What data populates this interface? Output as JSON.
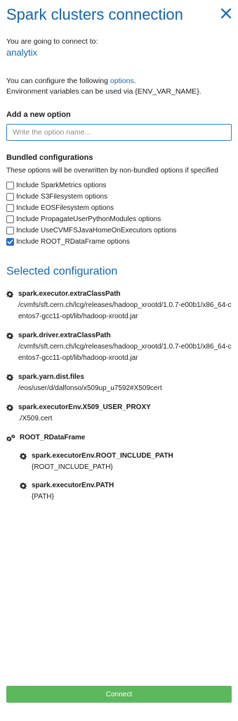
{
  "header": {
    "title": "Spark clusters connection"
  },
  "intro": {
    "text": "You are going to connect to:",
    "cluster": "analytix"
  },
  "configure": {
    "prefix": "You can configure the following ",
    "link": "options",
    "suffix": ".",
    "env_note": "Environment variables can be used via {ENV_VAR_NAME}."
  },
  "add_option": {
    "heading": "Add a new option",
    "placeholder": "Write the option name...",
    "value": ""
  },
  "bundled": {
    "heading": "Bundled configurations",
    "note": "These options will be overwritten by non-bundled options if specified",
    "items": [
      {
        "label": "Include SparkMetrics options",
        "checked": false
      },
      {
        "label": "Include S3Filesystem options",
        "checked": false
      },
      {
        "label": "Include EOSFilesystem options",
        "checked": false
      },
      {
        "label": "Include PropagateUserPythonModules options",
        "checked": false
      },
      {
        "label": "Include UseCVMFSJavaHomeOnExecutors options",
        "checked": false
      },
      {
        "label": "Include ROOT_RDataFrame options",
        "checked": true
      }
    ]
  },
  "selected": {
    "heading": "Selected configuration",
    "props": [
      {
        "name": "spark.executor.extraClassPath",
        "value": "/cvmfs/sft.cern.ch/lcg/releases/hadoop_xrootd/1.0.7-e00b1/x86_64-centos7-gcc11-opt/lib/hadoop-xrootd.jar"
      },
      {
        "name": "spark.driver.extraClassPath",
        "value": "/cvmfs/sft.cern.ch/lcg/releases/hadoop_xrootd/1.0.7-e00b1/x86_64-centos7-gcc11-opt/lib/hadoop-xrootd.jar"
      },
      {
        "name": "spark.yarn.dist.files",
        "value": "/eos/user/d/dalfonso/x509up_u7592#X509cert"
      },
      {
        "name": "spark.executorEnv.X509_USER_PROXY",
        "value": "./X509.cert"
      }
    ],
    "group": {
      "name": "ROOT_RDataFrame",
      "props": [
        {
          "name": "spark.executorEnv.ROOT_INCLUDE_PATH",
          "value": "{ROOT_INCLUDE_PATH}"
        },
        {
          "name": "spark.executorEnv.PATH",
          "value": "{PATH}"
        }
      ]
    }
  },
  "footer": {
    "connect_label": "Connect"
  },
  "colors": {
    "accent": "#1565a8",
    "connect": "#5cb85c",
    "checkbox": "#1f6fd1"
  },
  "icons": {
    "close": "close-icon",
    "gear": "gear-icon",
    "gears": "gears-icon",
    "check": "check-icon"
  }
}
